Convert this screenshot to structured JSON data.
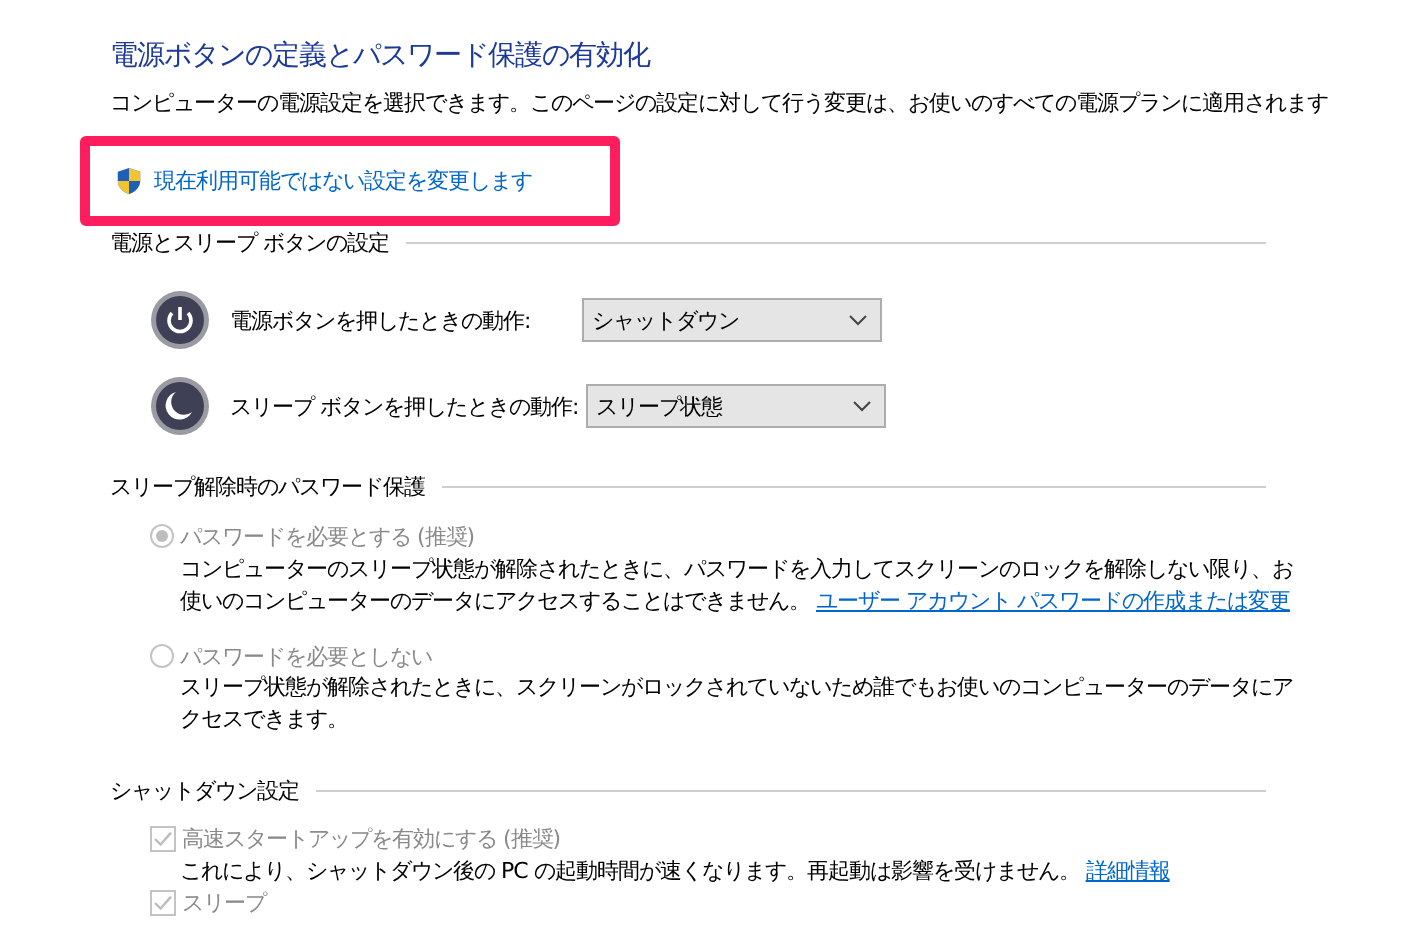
{
  "title": "電源ボタンの定義とパスワード保護の有効化",
  "description": "コンピューターの電源設定を選択できます。このページの設定に対して行う変更は、お使いのすべての電源プランに適用されます",
  "admin_link": "現在利用可能ではない設定を変更します",
  "sections": [
    {
      "kind": "buttons",
      "header": "電源とスリープ ボタンの設定",
      "rows": [
        {
          "label": "電源ボタンを押したときの動作:",
          "value": "シャットダウン"
        },
        {
          "label": "スリープ ボタンを押したときの動作:",
          "value": "スリープ状態"
        }
      ]
    },
    {
      "kind": "radios",
      "header": "スリープ解除時のパスワード保護",
      "options": [
        {
          "label": "パスワードを必要とする (推奨)",
          "selected": true,
          "disabled": true,
          "description": "コンピューターのスリープ状態が解除されたときに、パスワードを入力してスクリーンのロックを解除しない限り、お使いのコンピューターのデータにアクセスすることはできません。",
          "link": "ユーザー アカウント パスワードの作成または変更"
        },
        {
          "label": "パスワードを必要としない",
          "selected": false,
          "disabled": true,
          "description": "スリープ状態が解除されたときに、スクリーンがロックされていないため誰でもお使いのコンピューターのデータにアクセスできます。"
        }
      ]
    },
    {
      "kind": "checks",
      "header": "シャットダウン設定",
      "options": [
        {
          "label": "高速スタートアップを有効にする (推奨)",
          "checked": true,
          "disabled": true,
          "description": "これにより、シャットダウン後の PC の起動時間が速くなります。再起動は影響を受けません。",
          "link": "詳細情報"
        },
        {
          "label": "スリープ",
          "checked": true,
          "disabled": true
        }
      ]
    }
  ]
}
